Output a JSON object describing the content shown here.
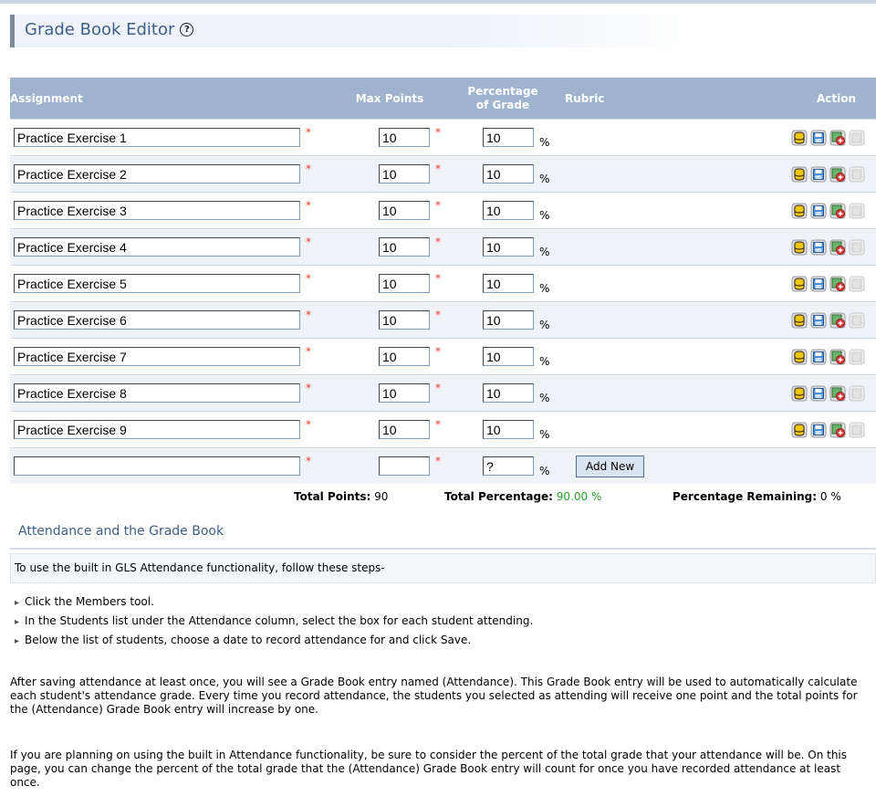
{
  "page": {
    "title": "Grade Book Editor",
    "help_icon": "question-circle-icon"
  },
  "table": {
    "headers": {
      "assignment": "Assignment",
      "max_points": "Max Points",
      "percentage": "Percentage of Grade",
      "rubric": "Rubric",
      "action": "Action"
    },
    "required_mark": "*",
    "percent_sign": "%",
    "rows": [
      {
        "name": "Practice Exercise 1",
        "points": "10",
        "percentage": "10"
      },
      {
        "name": "Practice Exercise 2",
        "points": "10",
        "percentage": "10"
      },
      {
        "name": "Practice Exercise 3",
        "points": "10",
        "percentage": "10"
      },
      {
        "name": "Practice Exercise 4",
        "points": "10",
        "percentage": "10"
      },
      {
        "name": "Practice Exercise 5",
        "points": "10",
        "percentage": "10"
      },
      {
        "name": "Practice Exercise 6",
        "points": "10",
        "percentage": "10"
      },
      {
        "name": "Practice Exercise 7",
        "points": "10",
        "percentage": "10"
      },
      {
        "name": "Practice Exercise 8",
        "points": "10",
        "percentage": "10"
      },
      {
        "name": "Practice Exercise 9",
        "points": "10",
        "percentage": "10"
      }
    ],
    "action_icons": [
      "database-icon",
      "save-icon",
      "add-rubric-icon",
      "disabled-icon"
    ],
    "new_row": {
      "name": "",
      "points": "",
      "percentage": "?",
      "add_button": "Add New"
    }
  },
  "totals": {
    "points_label": "Total Points:",
    "points_value": "90",
    "percentage_label": "Total Percentage:",
    "percentage_value": "90.00 %",
    "remaining_label": "Percentage Remaining:",
    "remaining_value": "0 %"
  },
  "attendance": {
    "title": "Attendance and the Grade Book",
    "intro": "To use the built in GLS Attendance functionality, follow these steps-",
    "steps": [
      "Click the Members tool.",
      "In the Students list under the Attendance column, select the box for each student attending.",
      "Below the list of students, choose a date to record attendance for and click Save."
    ],
    "paragraph1": "After saving attendance at least once, you will see a Grade Book entry named (Attendance). This Grade Book entry will be used to automatically calculate each student's attendance grade. Every time you record attendance, the students you selected as attending will receive one point and the total points for the (Attendance) Grade Book entry will increase by one.",
    "paragraph2": "If you are planning on using the built in Attendance functionality, be sure to consider the percent of the total grade that your attendance will be. On this page, you can change the percent of the total grade that the (Attendance) Grade Book entry will count for once you have recorded attendance at least once."
  },
  "colors": {
    "header_bg": "#9db3ce",
    "title_text": "#3f5f86",
    "required": "#e8382e",
    "total_percentage": "#23a02a"
  }
}
